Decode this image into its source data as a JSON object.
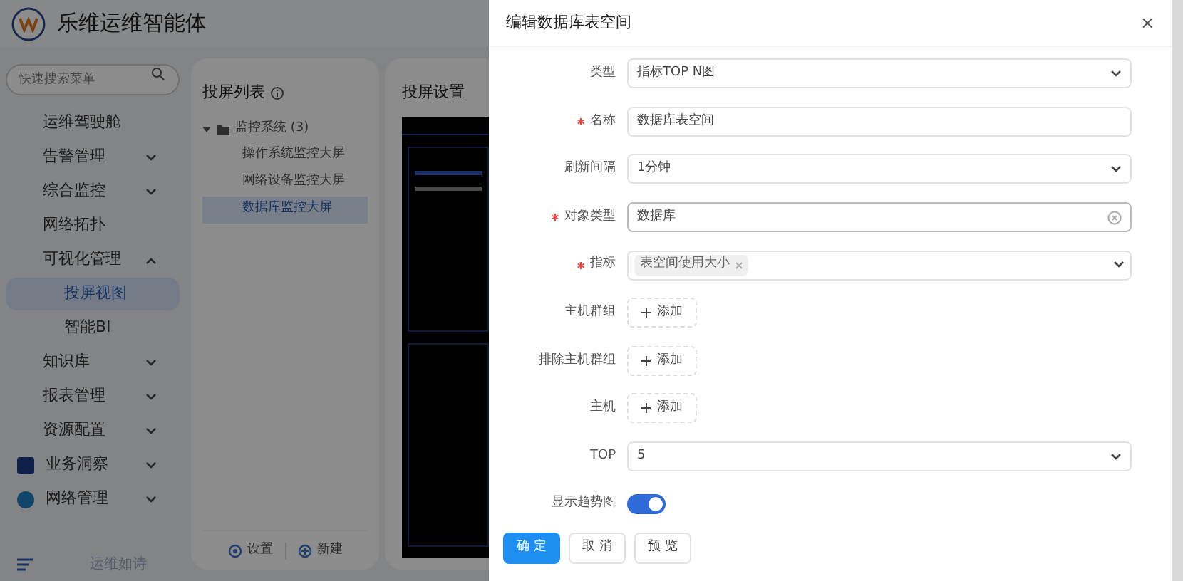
{
  "app": {
    "title": "乐维运维智能体"
  },
  "sidebar": {
    "search": {
      "placeholder": "快速搜索菜单"
    },
    "items": [
      {
        "label": "运维驾驶舱",
        "kind": "item"
      },
      {
        "label": "告警管理",
        "kind": "group",
        "expanded": false
      },
      {
        "label": "综合监控",
        "kind": "group",
        "expanded": false
      },
      {
        "label": "网络拓扑",
        "kind": "item"
      },
      {
        "label": "可视化管理",
        "kind": "group",
        "expanded": true,
        "children": [
          {
            "label": "投屏视图",
            "selected": true
          },
          {
            "label": "智能BI",
            "selected": false
          }
        ]
      },
      {
        "label": "知识库",
        "kind": "group",
        "expanded": false
      },
      {
        "label": "报表管理",
        "kind": "group",
        "expanded": false
      },
      {
        "label": "资源配置",
        "kind": "group",
        "expanded": false
      },
      {
        "label": "业务洞察",
        "kind": "module",
        "expanded": false
      },
      {
        "label": "网络管理",
        "kind": "module",
        "expanded": false
      }
    ],
    "footer": "运维如诗"
  },
  "screen_list": {
    "title": "投屏列表",
    "folder": {
      "label": "监控系统 (3)",
      "expanded": true,
      "children": [
        {
          "label": "操作系统监控大屏",
          "selected": false
        },
        {
          "label": "网络设备监控大屏",
          "selected": false
        },
        {
          "label": "数据库监控大屏",
          "selected": true
        }
      ]
    },
    "actions": [
      "设置",
      "新建"
    ]
  },
  "preview": {
    "title": "投屏设置"
  },
  "drawer": {
    "title": "编辑数据库表空间",
    "close": "×",
    "fields": [
      {
        "label": "类型",
        "required": false,
        "kind": "select",
        "value": "指标TOP N图"
      },
      {
        "label": "名称",
        "required": true,
        "kind": "input",
        "value": "数据库表空间"
      },
      {
        "label": "刷新间隔",
        "required": false,
        "kind": "select",
        "value": "1分钟"
      },
      {
        "label": "对象类型",
        "required": true,
        "kind": "clearable",
        "value": "数据库"
      },
      {
        "label": "指标",
        "required": true,
        "kind": "tags",
        "tags": [
          "表空间使用大小"
        ]
      },
      {
        "label": "主机群组",
        "required": false,
        "kind": "add",
        "value": "添加"
      },
      {
        "label": "排除主机群组",
        "required": false,
        "kind": "add",
        "value": "添加"
      },
      {
        "label": "主机",
        "required": false,
        "kind": "add",
        "value": "添加"
      },
      {
        "label": "TOP",
        "required": false,
        "kind": "select",
        "value": "5"
      },
      {
        "label": "显示趋势图",
        "required": false,
        "kind": "switch",
        "on": true
      }
    ],
    "buttons": [
      {
        "label": "确 定",
        "primary": true
      },
      {
        "label": "取 消",
        "primary": false
      },
      {
        "label": "预 览",
        "primary": false
      }
    ]
  }
}
